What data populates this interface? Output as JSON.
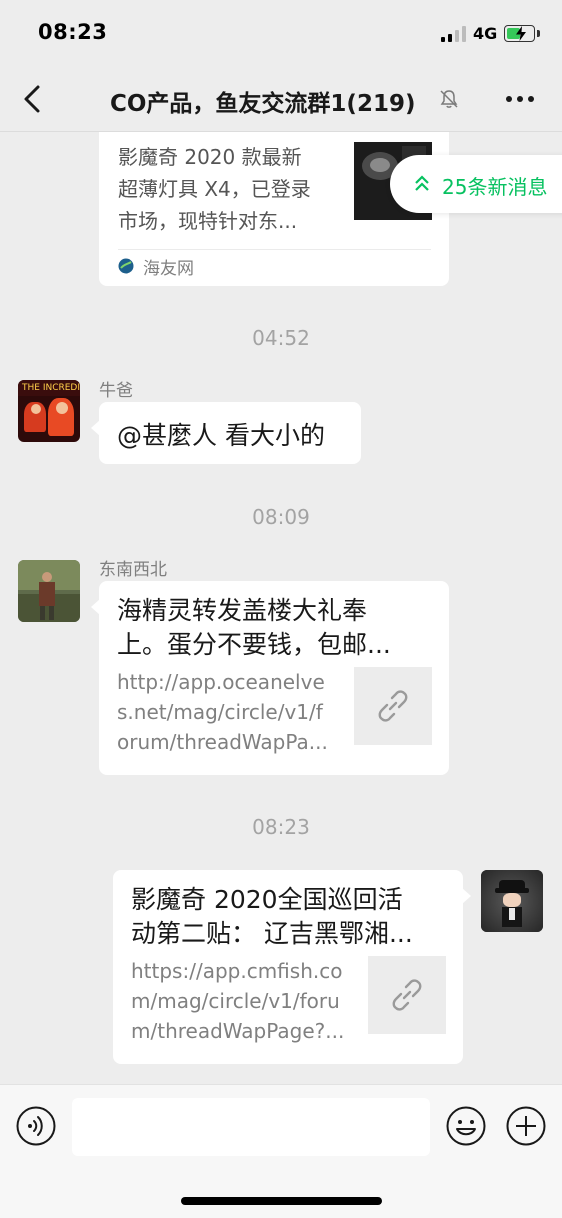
{
  "status_bar": {
    "time": "08:23",
    "network": "4G"
  },
  "nav": {
    "title": "CO产品，鱼友交流群1(219)"
  },
  "new_messages": {
    "label": "25条新消息"
  },
  "messages": {
    "card0": {
      "desc_lines": [
        "影魔奇 2020 款最新",
        "超薄灯具 X4，已登录",
        "市场，现特针对东..."
      ],
      "source": "海友网"
    },
    "time1": "04:52",
    "msg1": {
      "sender": "牛爸",
      "text": "@甚麼人 看大小的"
    },
    "time2": "08:09",
    "msg2": {
      "sender": "东南西北",
      "title_lines": [
        "海精灵转发盖楼大礼奉",
        "上。蛋分不要钱，包邮..."
      ],
      "url_lines": [
        "http://app.oceanelve",
        "s.net/mag/circle/v1/f",
        "orum/threadWapPa..."
      ]
    },
    "time3": "08:23",
    "msg3": {
      "title_lines": [
        "影魔奇 2020全国巡回活",
        "动第二贴： 辽吉黑鄂湘..."
      ],
      "url_lines": [
        "https://app.cmfish.co",
        "m/mag/circle/v1/foru",
        "m/threadWapPage?..."
      ]
    }
  }
}
